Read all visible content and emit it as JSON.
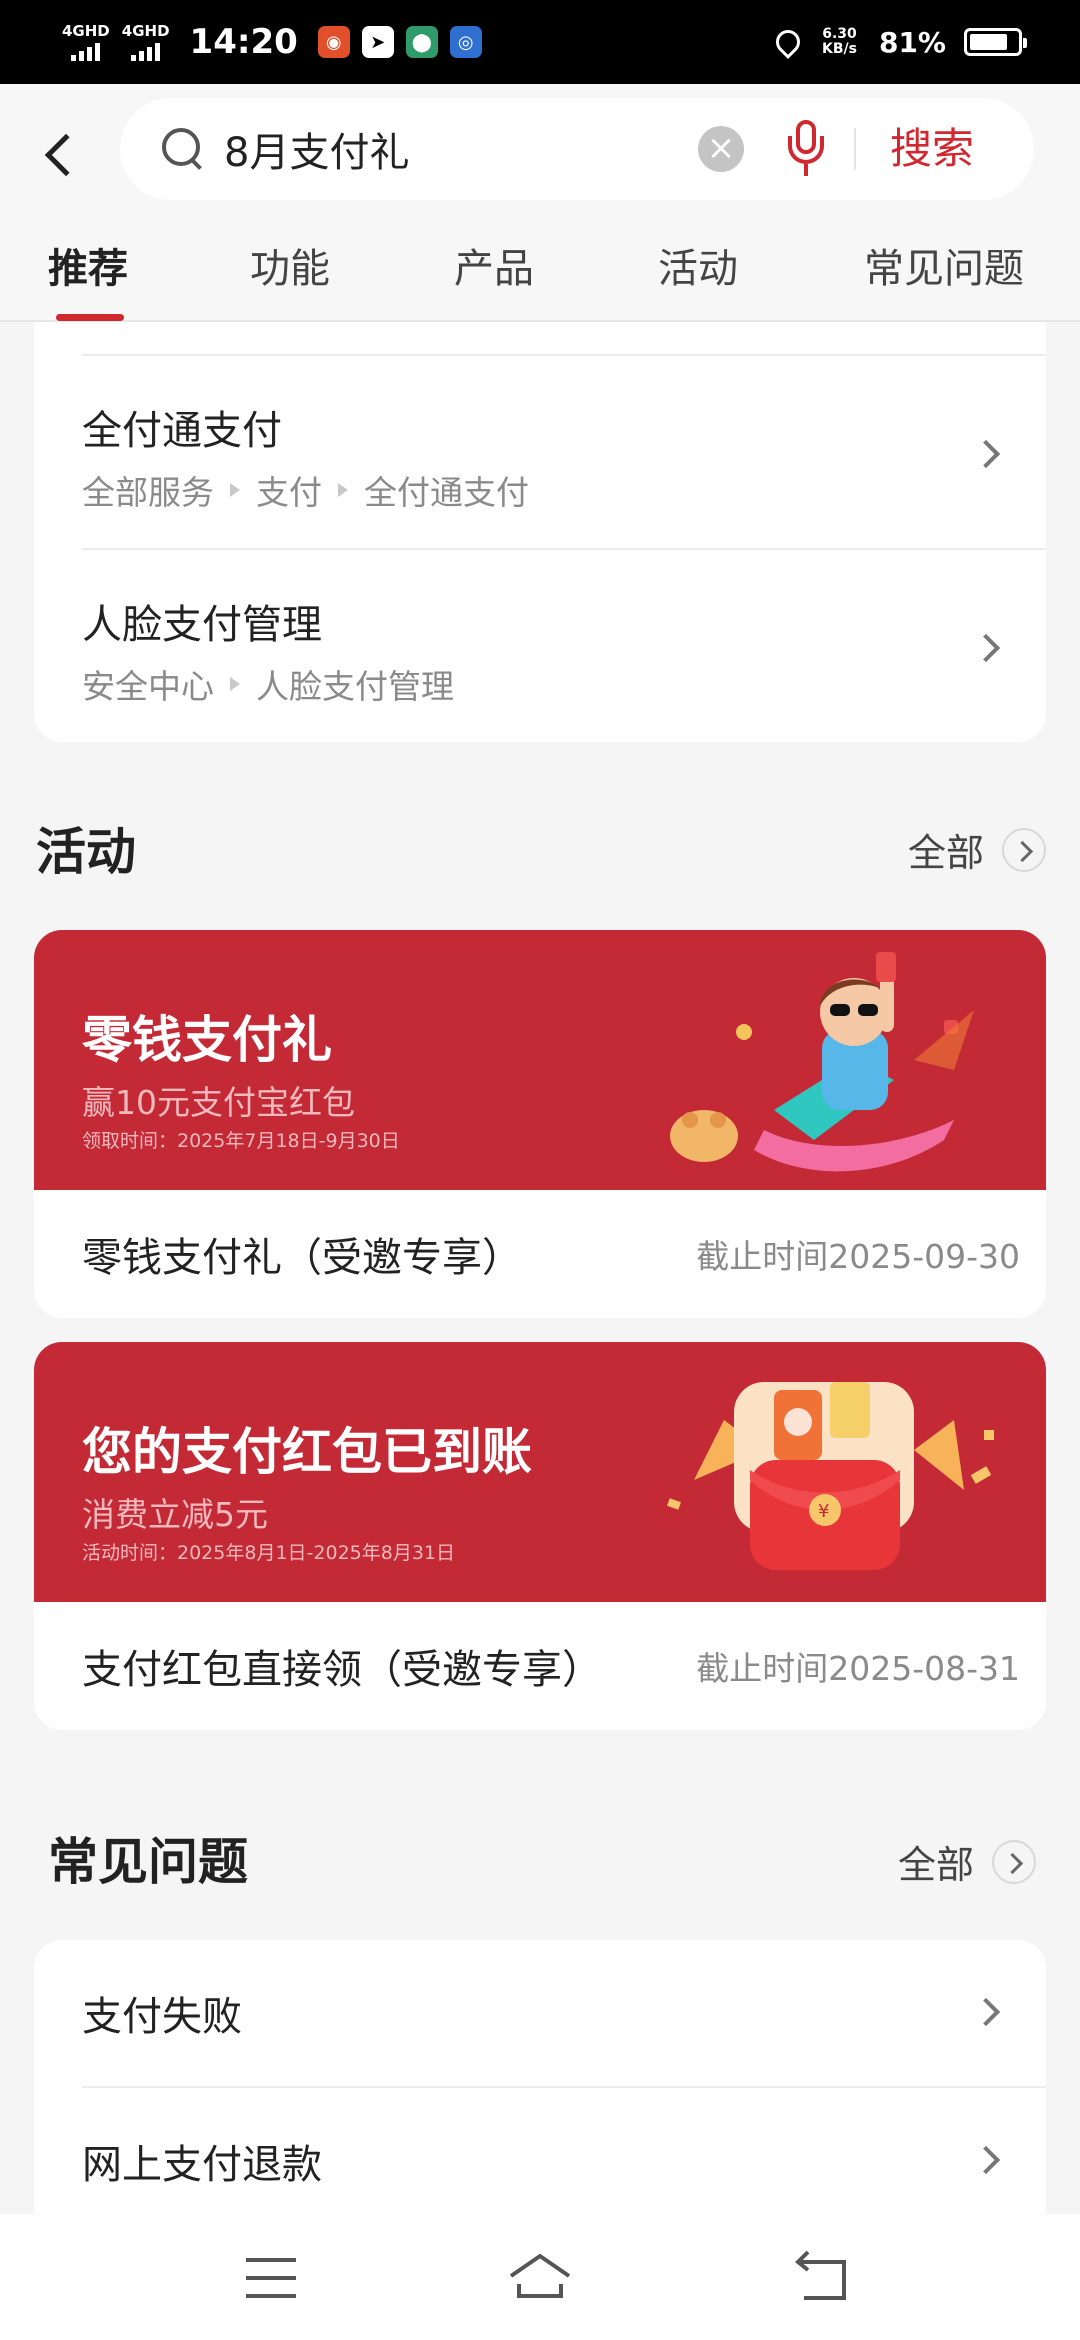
{
  "status_bar": {
    "network1": "4GHD",
    "network2": "4GHD",
    "time": "14:20",
    "speed_value": "6.30",
    "speed_unit": "KB/s",
    "battery": "81%",
    "battery_level": 0.81
  },
  "header": {
    "search_value": "8月支付礼",
    "search_button": "搜索",
    "tabs": [
      {
        "label": "推荐",
        "active": true
      },
      {
        "label": "功能",
        "active": false
      },
      {
        "label": "产品",
        "active": false
      },
      {
        "label": "活动",
        "active": false
      },
      {
        "label": "常见问题",
        "active": false
      }
    ]
  },
  "results": [
    {
      "title": "全付通支付",
      "path": [
        "全部服务",
        "支付",
        "全付通支付"
      ]
    },
    {
      "title": "人脸支付管理",
      "path": [
        "安全中心",
        "人脸支付管理"
      ]
    }
  ],
  "activities": {
    "section_title": "活动",
    "more_label": "全部",
    "items": [
      {
        "banner_title": "零钱支付礼",
        "banner_sub": "赢10元支付宝红包",
        "banner_date": "领取时间：2025年7月18日-9月30日",
        "name": "零钱支付礼（受邀专享）",
        "deadline": "截止时间2025-09-30"
      },
      {
        "banner_title": "您的支付红包已到账",
        "banner_sub": "消费立减5元",
        "banner_date": "活动时间：2025年8月1日-2025年8月31日",
        "name": "支付红包直接领（受邀专享）",
        "deadline": "截止时间2025-08-31"
      }
    ]
  },
  "faq": {
    "section_title": "常见问题",
    "more_label": "全部",
    "items": [
      "支付失败",
      "网上支付退款"
    ]
  },
  "colors": {
    "accent": "#d0282e",
    "banner": "#c42936"
  }
}
